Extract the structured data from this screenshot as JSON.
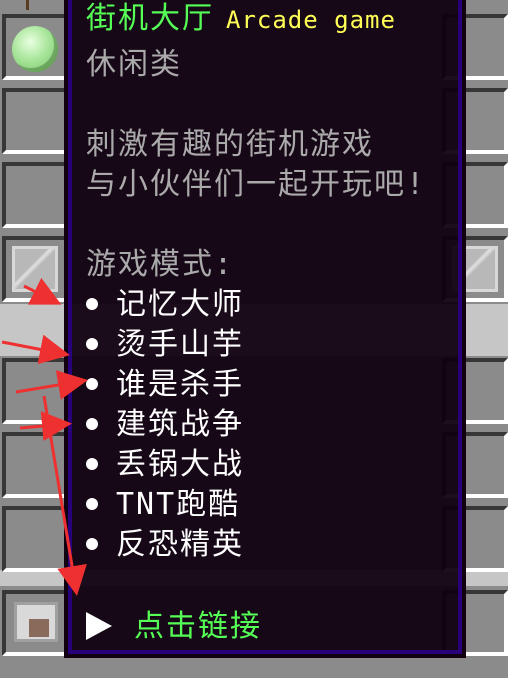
{
  "tooltip": {
    "title_cn": "街机大厅",
    "title_en": "Arcade game",
    "category": "休闲类",
    "desc_line1": "刺激有趣的街机游戏",
    "desc_line2": "与小伙伴们一起开玩吧!",
    "modes_header": "游戏模式:",
    "modes": [
      "记忆大师",
      "烫手山芋",
      "谁是杀手",
      "建筑战争",
      "丢锅大战",
      "TNT跑酷",
      "反恐精英"
    ],
    "link_label": "点击链接"
  },
  "colors": {
    "title_cn": "#55ff55",
    "title_en": "#ffff55",
    "grey_text": "#aaaaaa",
    "white_text": "#ffffff",
    "link_text": "#55ff55",
    "arrow_color": "#ee3030",
    "tooltip_bg": "#100010",
    "tooltip_border": "#28007a"
  },
  "icons": [
    "slime-ball-icon",
    "glass-pane-icon",
    "sheep-head-icon",
    "bullet-icon",
    "cursor-arrow-icon"
  ]
}
